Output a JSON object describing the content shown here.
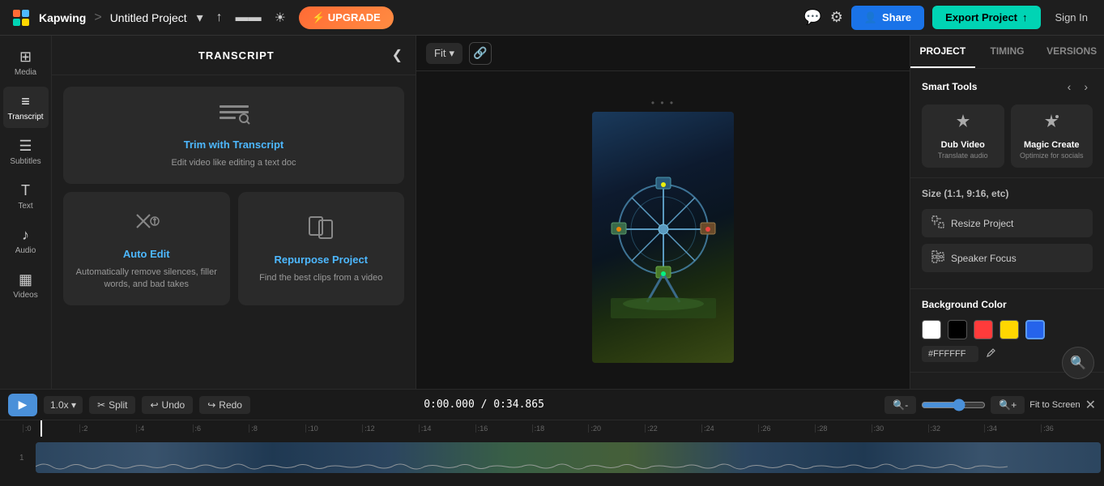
{
  "app": {
    "brand": "Kapwing",
    "separator": ">",
    "project_name": "Untitled Project",
    "upgrade_label": "⚡ UPGRADE"
  },
  "topbar": {
    "share_label": "Share",
    "export_label": "Export Project",
    "signin_label": "Sign In"
  },
  "left_sidebar": {
    "items": [
      {
        "id": "media",
        "icon": "⊞",
        "label": "Media"
      },
      {
        "id": "transcript",
        "icon": "≡≡",
        "label": "Transcript"
      },
      {
        "id": "subtitles",
        "icon": "☰",
        "label": "Subtitles"
      },
      {
        "id": "text",
        "icon": "✎",
        "label": "Text"
      },
      {
        "id": "audio",
        "icon": "♪",
        "label": "Audio"
      },
      {
        "id": "videos",
        "icon": "▦",
        "label": "Videos"
      }
    ]
  },
  "transcript_panel": {
    "title": "TRANSCRIPT",
    "tools": [
      {
        "id": "trim",
        "title": "Trim with Transcript",
        "desc": "Edit video like editing a text doc",
        "icon": "≡✂",
        "size": "large"
      },
      {
        "id": "auto_edit",
        "title": "Auto Edit",
        "desc": "Automatically remove silences, filler words, and bad takes",
        "icon": "✂✦",
        "size": "small"
      },
      {
        "id": "repurpose",
        "title": "Repurpose Project",
        "desc": "Find the best clips from a video",
        "icon": "⧉",
        "size": "small"
      }
    ]
  },
  "video_toolbar": {
    "fit_label": "Fit",
    "chevron": "▾"
  },
  "right_panel": {
    "tabs": [
      "PROJECT",
      "TIMING",
      "VERSIONS"
    ],
    "active_tab": "PROJECT",
    "smart_tools_title": "Smart Tools",
    "smart_tools": [
      {
        "id": "dub_video",
        "icon": "✦",
        "label": "Dub Video",
        "sublabel": "Translate audio"
      },
      {
        "id": "magic_create",
        "icon": "✦✦",
        "label": "Magic Create",
        "sublabel": "Optimize for socials"
      }
    ],
    "size_section_title": "Size (1:1, 9:16, etc)",
    "resize_label": "Resize Project",
    "speaker_focus_label": "Speaker Focus",
    "bg_color_title": "Background Color",
    "bg_color_hex": "#FFFFFF",
    "bg_colors": [
      {
        "color": "#FFFFFF"
      },
      {
        "color": "#000000"
      },
      {
        "color": "#FF3B3B"
      },
      {
        "color": "#FFD700"
      },
      {
        "color": "#2563EB"
      }
    ]
  },
  "timeline": {
    "play_icon": "▶",
    "speed_label": "1.0x",
    "split_label": "Split",
    "undo_label": "Undo",
    "redo_label": "Redo",
    "timecode": "0:00.000 / 0:34.865",
    "fit_screen_label": "Fit to Screen",
    "ruler_marks": [
      ":0",
      ":2",
      ":4",
      ":6",
      ":8",
      ":10",
      ":12",
      ":14",
      ":16",
      ":18",
      ":20",
      ":22",
      ":24",
      ":26",
      ":28",
      ":30",
      ":32",
      ":34",
      ":36"
    ],
    "track_number": "1"
  }
}
